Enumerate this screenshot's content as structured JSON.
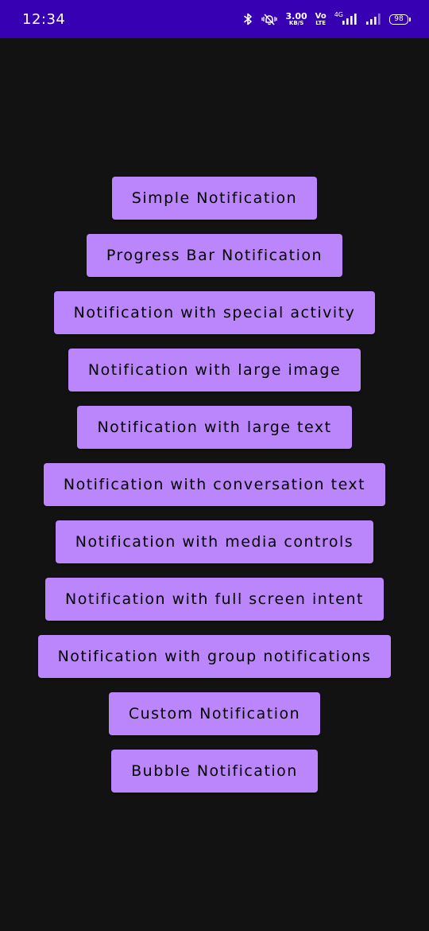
{
  "status_bar": {
    "time": "12:34",
    "speed_value": "3.00",
    "speed_unit": "KB/S",
    "volte_top": "Vo",
    "volte_bottom": "LTE",
    "network_type": "4G",
    "battery_level": "98",
    "background_color": "#3700b3"
  },
  "buttons": [
    {
      "label": "Simple Notification"
    },
    {
      "label": "Progress Bar Notification"
    },
    {
      "label": "Notification with special activity"
    },
    {
      "label": "Notification with large image"
    },
    {
      "label": "Notification with large text"
    },
    {
      "label": "Notification with conversation text"
    },
    {
      "label": "Notification with media controls"
    },
    {
      "label": "Notification with full screen intent"
    },
    {
      "label": "Notification with group notifications"
    },
    {
      "label": "Custom Notification"
    },
    {
      "label": "Bubble Notification"
    }
  ],
  "colors": {
    "background": "#121212",
    "button": "#bb86fc",
    "button_text": "#000000"
  }
}
